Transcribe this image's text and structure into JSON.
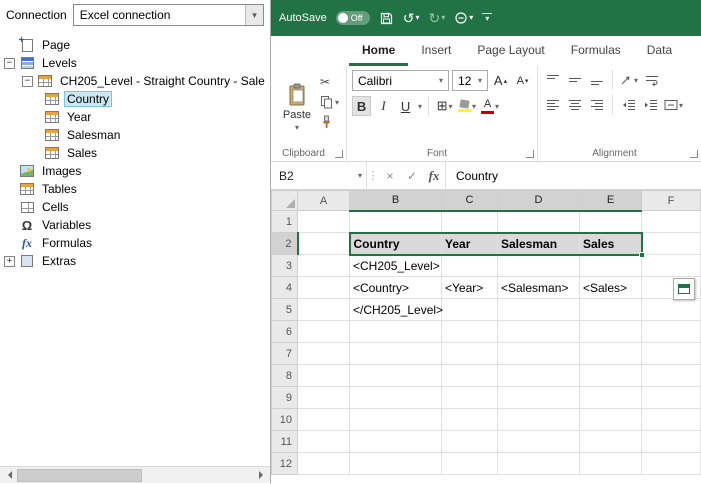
{
  "colors": {
    "excel_green": "#217346",
    "selection_border": "#217346",
    "header_fill": "#D9D9D9",
    "fill_color_swatch": "#FFFF00",
    "font_color_swatch": "#C00000",
    "tree_selection": "#CBE8F6"
  },
  "icons": {
    "caret_down": "▾",
    "undo": "↺",
    "redo": "↻",
    "cut": "✂",
    "borders": "⊞",
    "omega": "Ω",
    "fx": "fx",
    "close": "×",
    "check": "✓",
    "minus": "−",
    "plus": "+",
    "splitter": "⋮"
  },
  "left_panel": {
    "connection_label": "Connection",
    "connection_value": "Excel connection",
    "tree": [
      {
        "label": "Page"
      },
      {
        "label": "Levels"
      },
      {
        "label": "CH205_Level - Straight Country - Sale"
      },
      {
        "label": "Country"
      },
      {
        "label": "Year"
      },
      {
        "label": "Salesman"
      },
      {
        "label": "Sales"
      },
      {
        "label": "Images"
      },
      {
        "label": "Tables"
      },
      {
        "label": "Cells"
      },
      {
        "label": "Variables"
      },
      {
        "label": "Formulas"
      },
      {
        "label": "Extras"
      }
    ]
  },
  "excel": {
    "titlebar": {
      "autosave_label": "AutoSave",
      "autosave_state": "Off"
    },
    "tabs": [
      {
        "label": "Home"
      },
      {
        "label": "Insert"
      },
      {
        "label": "Page Layout"
      },
      {
        "label": "Formulas"
      },
      {
        "label": "Data"
      }
    ],
    "ribbon": {
      "paste_label": "Paste",
      "font_name": "Calibri",
      "font_size": "12",
      "bold": "B",
      "italic": "I",
      "underline": "U",
      "increase_font": "A",
      "decrease_font": "A",
      "font_color_letter": "A",
      "groups": {
        "clipboard": "Clipboard",
        "font": "Font",
        "alignment": "Alignment"
      }
    },
    "formula_bar": {
      "name_box": "B2",
      "fx_label": "fx",
      "content": "Country"
    },
    "grid": {
      "columns": [
        "A",
        "B",
        "C",
        "D",
        "E",
        "F"
      ],
      "rows": [
        "1",
        "2",
        "3",
        "4",
        "5",
        "6",
        "7",
        "8",
        "9",
        "10",
        "11",
        "12"
      ],
      "cells": {
        "B2": "Country",
        "C2": "Year",
        "D2": "Salesman",
        "E2": "Sales",
        "B3": "<CH205_Level>",
        "B4": "<Country>",
        "C4": "<Year>",
        "D4": "<Salesman>",
        "E4": "<Sales>",
        "B5": "</CH205_Level>"
      }
    }
  }
}
